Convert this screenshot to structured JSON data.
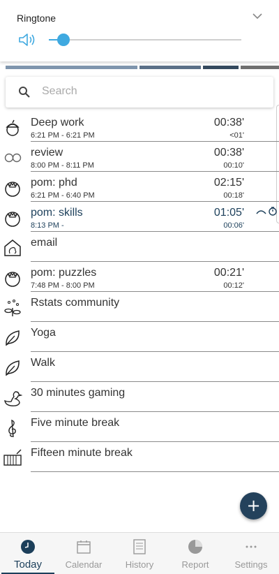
{
  "volume": {
    "title": "Ringtone",
    "level": 0.07,
    "speaker_icon": "speaker-icon",
    "collapse_icon": "chevron-down-icon",
    "accent_color": "#3fa9e0"
  },
  "color_strip": [
    "#7f95ad",
    "#5b7088",
    "#34495e",
    "#6f6f6f"
  ],
  "search": {
    "placeholder": "Search",
    "icon": "search-icon"
  },
  "activities": [
    {
      "name": "Deep work",
      "range": "6:21 PM - 6:21 PM",
      "duration": "00:38'",
      "sub": "<01'",
      "icon": "acorn-icon"
    },
    {
      "name": "review",
      "range": "8:00 PM - 8:11 PM",
      "duration": "00:38'",
      "sub": "00:10'",
      "icon": "infinity-icon"
    },
    {
      "name": "pom: phd",
      "range": "6:21 PM - 6:40 PM",
      "duration": "02:15'",
      "sub": "00:18'",
      "icon": "tomato-icon"
    },
    {
      "name": "pom: skills",
      "range": "8:13 PM -",
      "duration": "01:05'",
      "sub": "00:06'",
      "icon": "tomato-icon",
      "active": true
    },
    {
      "name": "email",
      "range": "",
      "duration": "",
      "sub": "",
      "icon": "house-icon"
    },
    {
      "name": "pom: puzzles",
      "range": "7:48 PM - 8:00 PM",
      "duration": "00:21'",
      "sub": "00:12'",
      "icon": "tomato-icon"
    },
    {
      "name": "Rstats community",
      "range": "",
      "duration": "",
      "sub": "",
      "icon": "sprout-icon"
    },
    {
      "name": "Yoga",
      "range": "",
      "duration": "",
      "sub": "",
      "icon": "leaf-icon"
    },
    {
      "name": "Walk",
      "range": "",
      "duration": "",
      "sub": "",
      "icon": "leaf-icon"
    },
    {
      "name": "30 minutes gaming",
      "range": "",
      "duration": "",
      "sub": "",
      "icon": "duck-icon"
    },
    {
      "name": "Five minute break",
      "range": "",
      "duration": "",
      "sub": "",
      "icon": "treble-clef-icon"
    },
    {
      "name": "Fifteen minute break",
      "range": "",
      "duration": "",
      "sub": "",
      "icon": "xylophone-icon"
    }
  ],
  "active_color": "#1c3f5a",
  "fab": {
    "label": "+",
    "icon": "plus-icon"
  },
  "nav": [
    {
      "label": "Today",
      "icon": "clock-icon",
      "selected": true
    },
    {
      "label": "Calendar",
      "icon": "calendar-icon"
    },
    {
      "label": "History",
      "icon": "history-icon"
    },
    {
      "label": "Report",
      "icon": "pie-chart-icon"
    },
    {
      "label": "Settings",
      "icon": "more-dots-icon"
    }
  ]
}
